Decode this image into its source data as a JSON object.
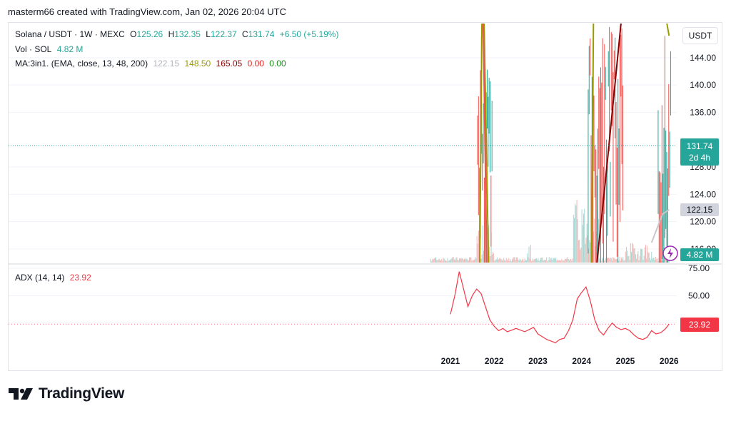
{
  "header": {
    "text": "masterm66 created with TradingView.com, Jan 02, 2026 20:04 UTC"
  },
  "legend": {
    "symbol": "Solana / USDT · 1W · MEXC",
    "o_label": "O",
    "o": "125.26",
    "h_label": "H",
    "h": "132.35",
    "l_label": "L",
    "l": "122.37",
    "c_label": "C",
    "c": "131.74",
    "change": "+6.50 (+5.19%)",
    "vol_label": "Vol · SOL",
    "vol": "4.82 M",
    "ma_label": "MA:3in1. (EMA, close, 13, 48, 200)",
    "ma_values": [
      "122.15",
      "148.50",
      "165.05",
      "0.00",
      "0.00"
    ],
    "adx_label": "ADX (14, 14)",
    "adx": "23.92"
  },
  "price_scale": {
    "unit": "USDT",
    "ticks": [
      "144.00",
      "140.00",
      "136.00",
      "128.00",
      "124.00",
      "120.00",
      "116.00"
    ],
    "last_price": "131.74",
    "countdown": "2d 4h",
    "ma_tag": "122.15",
    "vol_tag": "4.82 M"
  },
  "adx_scale": {
    "ticks": [
      "75.00",
      "50.00"
    ],
    "adx_tag": "23.92"
  },
  "time_axis": {
    "labels": [
      "2021",
      "2022",
      "2023",
      "2024",
      "2025",
      "2026"
    ]
  },
  "colors": {
    "up": "#26a69a",
    "down": "#ef5350",
    "ema13": "#c8c8c8",
    "ema48": "#9b9b00",
    "ema200": "#8b0000",
    "adx": "#f23645",
    "last": "#26a69a",
    "grid": "#f0f3fa"
  },
  "chart_data": {
    "type": "line",
    "title": "Solana / USDT · 1W · MEXC",
    "y_range_price": [
      114,
      149
    ],
    "y_range_adx": [
      0,
      75
    ],
    "x_range": [
      2020.4,
      2026.1
    ],
    "series": [
      {
        "name": "ADX (14, 14)",
        "x": [
          2021.0,
          2021.1,
          2021.2,
          2021.3,
          2021.4,
          2021.5,
          2021.6,
          2021.7,
          2021.8,
          2021.9,
          2022.0,
          2022.1,
          2022.2,
          2022.3,
          2022.5,
          2022.7,
          2022.9,
          2023.0,
          2023.2,
          2023.4,
          2023.5,
          2023.6,
          2023.7,
          2023.8,
          2023.9,
          2024.0,
          2024.1,
          2024.2,
          2024.3,
          2024.4,
          2024.5,
          2024.6,
          2024.7,
          2024.8,
          2024.9,
          2025.0,
          2025.1,
          2025.2,
          2025.3,
          2025.4,
          2025.5,
          2025.6,
          2025.7,
          2025.8,
          2025.9,
          2026.0
        ],
        "values": [
          33,
          50,
          72,
          56,
          40,
          50,
          56,
          52,
          40,
          28,
          22,
          18,
          20,
          17,
          20,
          17,
          21,
          15,
          10,
          7,
          10,
          11,
          18,
          28,
          47,
          53,
          58,
          45,
          28,
          18,
          14,
          20,
          25,
          21,
          19,
          20,
          18,
          14,
          11,
          10,
          12,
          18,
          15,
          16,
          19,
          24
        ]
      }
    ]
  }
}
